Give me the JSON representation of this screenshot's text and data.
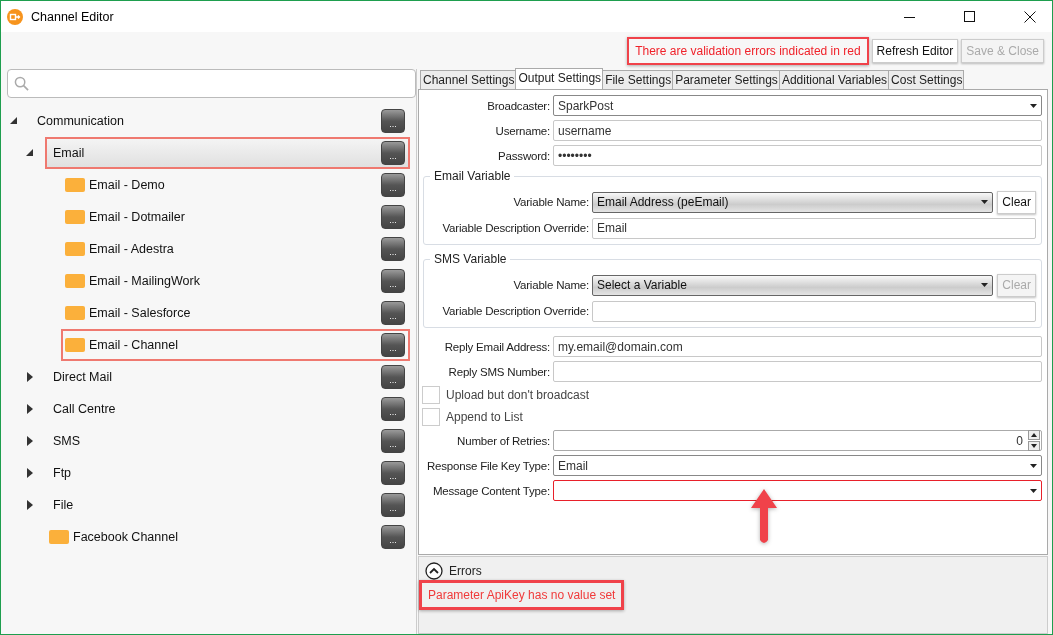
{
  "window": {
    "title": "Channel Editor"
  },
  "toolbar": {
    "message": {
      "text": "There are validation errors indicated in red",
      "highlighted": true
    },
    "buttons": [
      {
        "label": "Refresh Editor",
        "disabled": false
      },
      {
        "label": "Save & Close",
        "disabled": true
      }
    ]
  },
  "tree": [
    {
      "label": "Communication",
      "kind": "group",
      "expanded": true,
      "selected": false,
      "highlighted": false,
      "button": "...",
      "children": [
        {
          "label": "Email",
          "kind": "group",
          "expanded": true,
          "selected": true,
          "highlighted": true,
          "button": "...",
          "children": [
            {
              "label": "Email - Demo",
              "kind": "channel",
              "selected": false,
              "highlighted": false,
              "button": "..."
            },
            {
              "label": "Email - Dotmailer",
              "kind": "channel",
              "selected": false,
              "highlighted": false,
              "button": "..."
            },
            {
              "label": "Email - Adestra",
              "kind": "channel",
              "selected": false,
              "highlighted": false,
              "button": "..."
            },
            {
              "label": "Email - MailingWork",
              "kind": "channel",
              "selected": false,
              "highlighted": false,
              "button": "..."
            },
            {
              "label": "Email - Salesforce",
              "kind": "channel",
              "selected": false,
              "highlighted": false,
              "button": "..."
            },
            {
              "label": "Email - Channel",
              "kind": "channel",
              "selected": false,
              "highlighted": true,
              "button": "..."
            }
          ]
        },
        {
          "label": "Direct Mail",
          "kind": "group",
          "expanded": false,
          "selected": false,
          "highlighted": false,
          "button": "..."
        },
        {
          "label": "Call Centre",
          "kind": "group",
          "expanded": false,
          "selected": false,
          "highlighted": false,
          "button": "..."
        },
        {
          "label": "SMS",
          "kind": "group",
          "expanded": false,
          "selected": false,
          "highlighted": false,
          "button": "..."
        },
        {
          "label": "Ftp",
          "kind": "group",
          "expanded": false,
          "selected": false,
          "highlighted": false,
          "button": "..."
        },
        {
          "label": "File",
          "kind": "group",
          "expanded": false,
          "selected": false,
          "highlighted": false,
          "button": "..."
        },
        {
          "label": "Facebook Channel",
          "kind": "channel",
          "selected": false,
          "highlighted": false,
          "button": "..."
        }
      ]
    }
  ],
  "tabs": [
    {
      "label": "Channel Settings",
      "selected": false
    },
    {
      "label": "Output Settings",
      "selected": true
    },
    {
      "label": "File Settings",
      "selected": false
    },
    {
      "label": "Parameter Settings",
      "selected": false
    },
    {
      "label": "Additional Variables",
      "selected": false
    },
    {
      "label": "Cost Settings",
      "selected": false
    }
  ],
  "form": [
    {
      "kind": "select",
      "label": "Broadcaster:",
      "value": "SparkPost",
      "invalid": false
    },
    {
      "kind": "text",
      "label": "Username:",
      "value": "username"
    },
    {
      "kind": "text",
      "label": "Password:",
      "value": "••••••••"
    },
    {
      "kind": "group",
      "title": "Email Variable",
      "rows": [
        {
          "kind": "variable",
          "label": "Variable Name:",
          "value": "Email Address (peEmail)",
          "clear": {
            "label": "Clear",
            "disabled": false
          }
        },
        {
          "kind": "text",
          "label": "Variable Description Override:",
          "value": "Email"
        }
      ]
    },
    {
      "kind": "group",
      "title": "SMS Variable",
      "rows": [
        {
          "kind": "variable",
          "label": "Variable Name:",
          "value": "Select a Variable",
          "clear": {
            "label": "Clear",
            "disabled": true
          }
        },
        {
          "kind": "text",
          "label": "Variable Description Override:"
        }
      ]
    },
    {
      "kind": "text",
      "label": "Reply Email Address:",
      "value": "my.email@domain.com"
    },
    {
      "kind": "text",
      "label": "Reply SMS Number:"
    },
    {
      "kind": "checkbox",
      "label": "Upload but don't broadcast",
      "checked": false
    },
    {
      "kind": "checkbox",
      "label": "Append to List",
      "checked": false
    },
    {
      "kind": "spinner",
      "label": "Number of Retries:",
      "value": "0"
    },
    {
      "kind": "select",
      "label": "Response File Key Type:",
      "value": "Email",
      "invalid": false
    },
    {
      "kind": "select",
      "label": "Message Content Type:",
      "invalid": true
    }
  ],
  "errors": {
    "title": "Errors",
    "expanded": true,
    "messages": [
      {
        "text": "Parameter ApiKey has no value set",
        "highlighted": true
      }
    ]
  }
}
